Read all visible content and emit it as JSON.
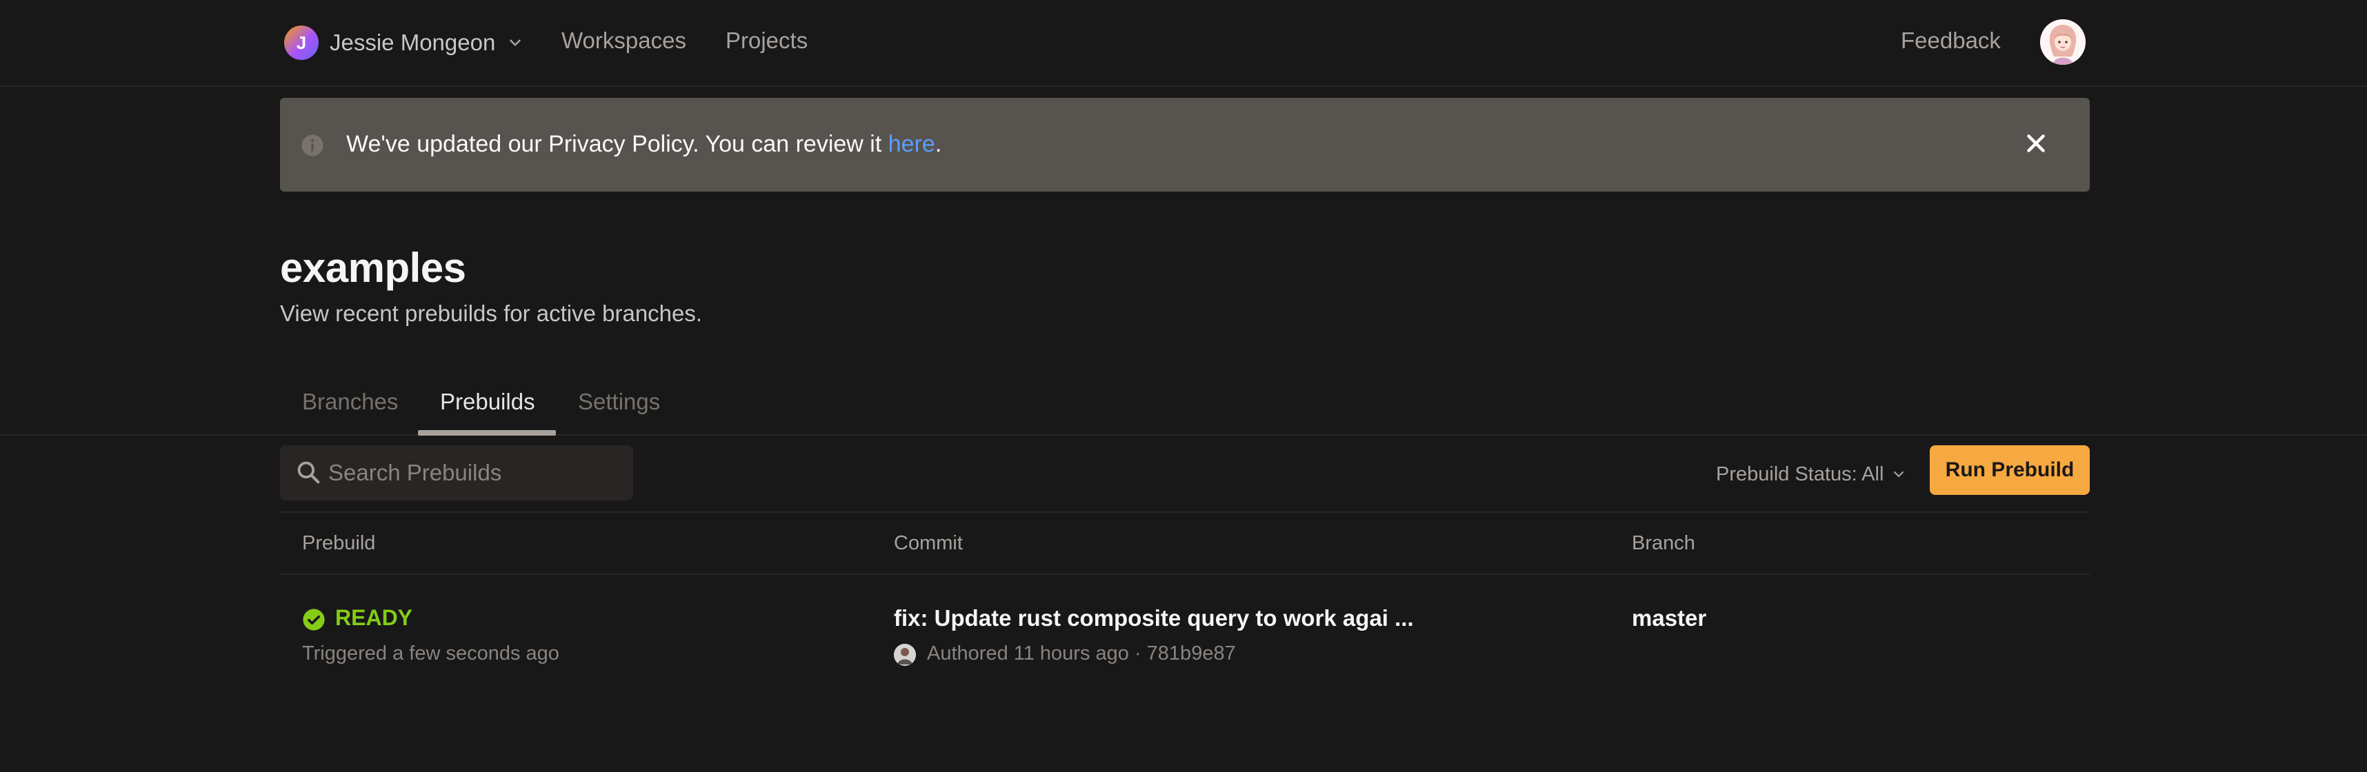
{
  "topnav": {
    "org_initial": "J",
    "org_name": "Jessie Mongeon",
    "links": [
      "Workspaces",
      "Projects"
    ],
    "feedback": "Feedback"
  },
  "notice": {
    "text_before": "We've updated our Privacy Policy. You can review it ",
    "link_text": "here",
    "text_after": "."
  },
  "project": {
    "title": "examples",
    "subtitle": "View recent prebuilds for active branches."
  },
  "tabs": [
    {
      "label": "Branches",
      "active": false
    },
    {
      "label": "Prebuilds",
      "active": true
    },
    {
      "label": "Settings",
      "active": false
    }
  ],
  "toolbar": {
    "search_placeholder": "Search Prebuilds",
    "search_value": "",
    "status_filter": "Prebuild Status: All",
    "run_button": "Run Prebuild"
  },
  "table": {
    "columns": [
      "Prebuild",
      "Commit",
      "Branch"
    ],
    "rows": [
      {
        "status": "READY",
        "triggered": "Triggered a few seconds ago",
        "commit_message": "fix: Update rust composite query to work agai ...",
        "commit_meta": "Authored 11 hours ago · 781b9e87",
        "branch": "master"
      }
    ]
  },
  "colors": {
    "background": "#181818",
    "banner": "#57534e",
    "link": "#5b9dff",
    "ready": "#84cc16",
    "primary_button": "#f7a941"
  },
  "icons": [
    "chevron-down-icon",
    "info-icon",
    "close-icon",
    "search-icon",
    "check-circle-icon"
  ]
}
